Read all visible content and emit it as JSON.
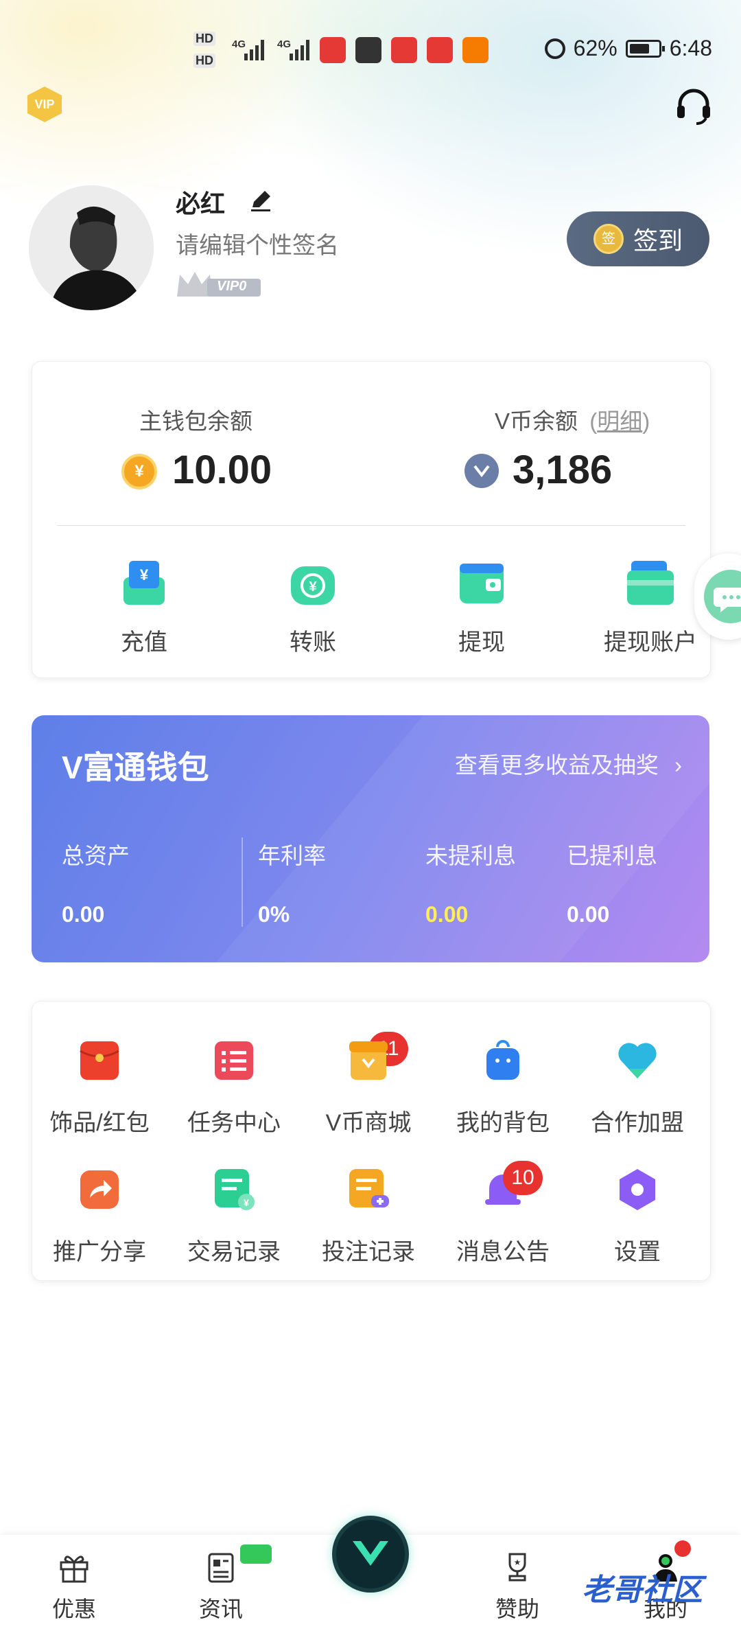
{
  "status_bar": {
    "hd1": "HD",
    "hd2": "HD",
    "net1": "4G",
    "net2": "4G",
    "battery": "62%",
    "time": "6:48"
  },
  "header": {
    "vip_label": "VIP"
  },
  "profile": {
    "name": "必红",
    "signature": "请编辑个性签名",
    "vip_level": "VIP0",
    "signin_label": "签到",
    "signin_coin": "签"
  },
  "wallet": {
    "main_label": "主钱包余额",
    "main_value": "10.00",
    "vcoin_label": "V币余额",
    "detail_link": "明细",
    "vcoin_value": "3,186",
    "actions": [
      {
        "label": "充值"
      },
      {
        "label": "转账"
      },
      {
        "label": "提现"
      },
      {
        "label": "提现账户"
      }
    ]
  },
  "vbank": {
    "title": "V富通钱包",
    "more": "查看更多收益及抽奖",
    "stats": [
      {
        "label": "总资产",
        "value": "0.00"
      },
      {
        "label": "年利率",
        "value": "0%"
      },
      {
        "label": "未提利息",
        "value": "0.00"
      },
      {
        "label": "已提利息",
        "value": "0.00"
      }
    ],
    "highlight_color": "#ffee58"
  },
  "features": [
    {
      "label": "饰品/红包",
      "icon": "red-envelope-icon"
    },
    {
      "label": "任务中心",
      "icon": "task-icon",
      "badge": "11"
    },
    {
      "label": "V币商城",
      "icon": "shop-icon"
    },
    {
      "label": "我的背包",
      "icon": "backpack-icon"
    },
    {
      "label": "合作加盟",
      "icon": "heart-icon"
    },
    {
      "label": "推广分享",
      "icon": "share-icon"
    },
    {
      "label": "交易记录",
      "icon": "transaction-icon"
    },
    {
      "label": "投注记录",
      "icon": "bet-record-icon"
    },
    {
      "label": "消息公告",
      "icon": "bell-icon",
      "badge": "10"
    },
    {
      "label": "设置",
      "icon": "settings-icon"
    }
  ],
  "nav": [
    {
      "label": "优惠",
      "icon": "gift-icon"
    },
    {
      "label": "资讯",
      "icon": "news-icon"
    },
    {
      "label": "赞助",
      "icon": "trophy-icon"
    },
    {
      "label": "我的",
      "icon": "user-icon"
    }
  ],
  "watermark": "老哥社区"
}
